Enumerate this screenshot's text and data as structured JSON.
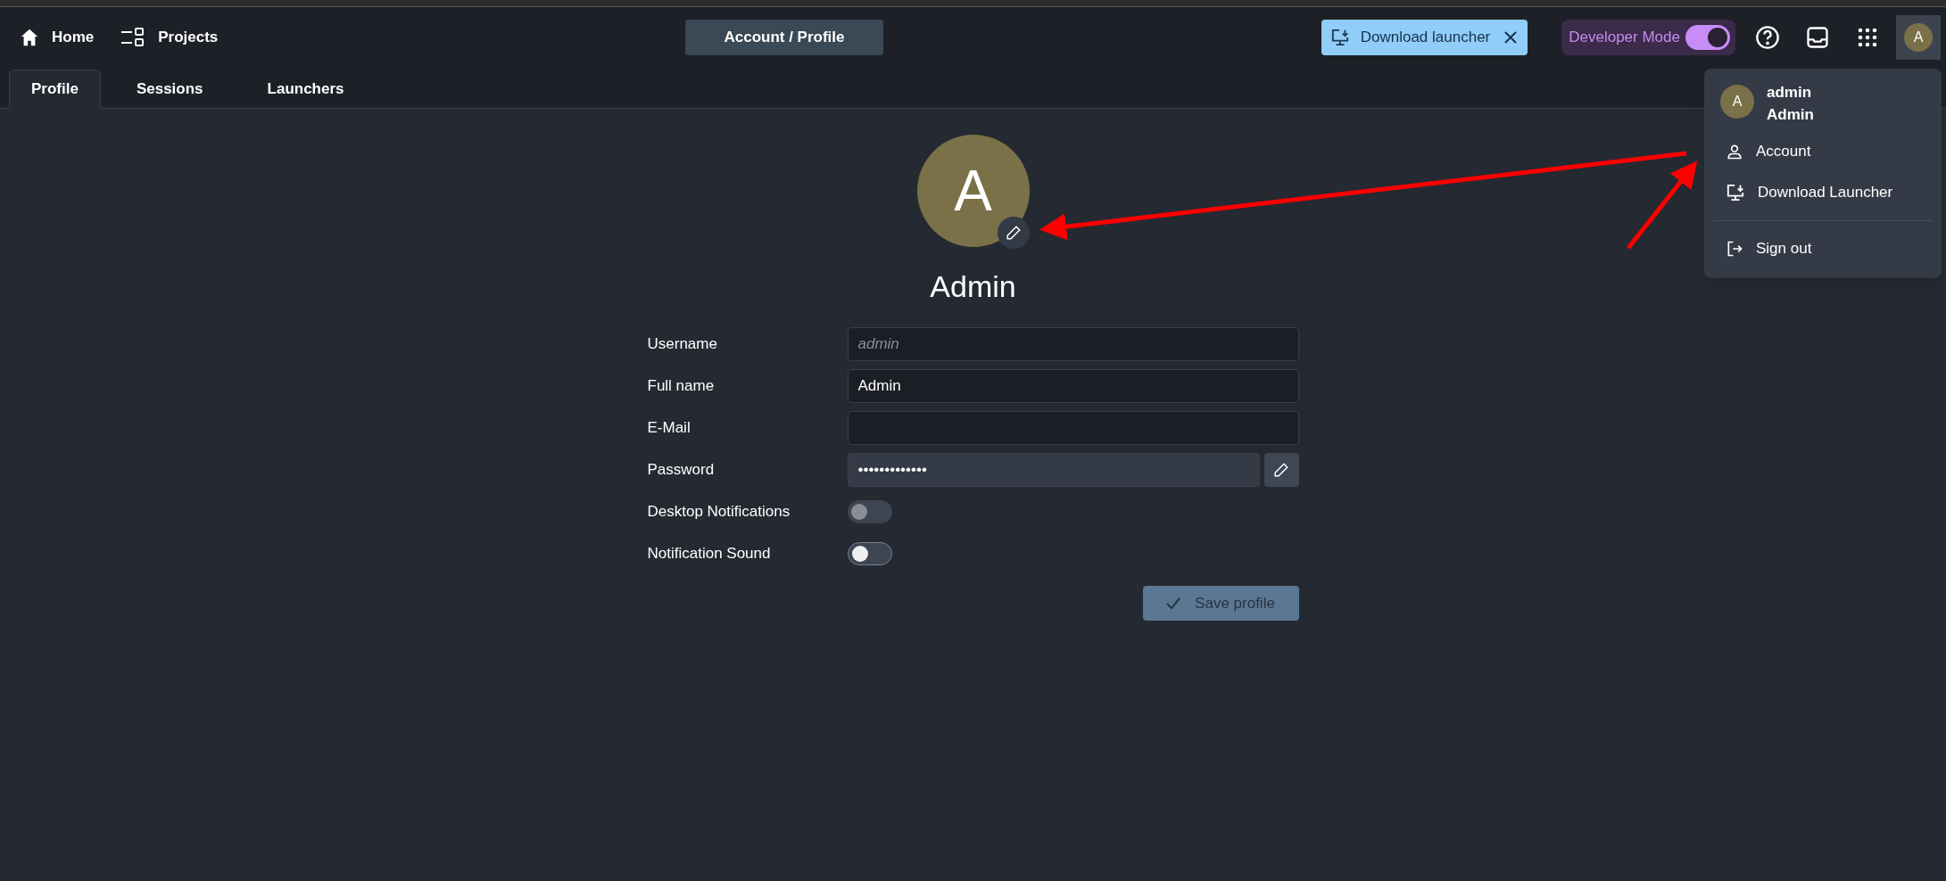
{
  "nav": [
    {
      "kind": "home",
      "label": "Home"
    },
    {
      "kind": "projects",
      "label": "Projects"
    }
  ],
  "breadcrumb": "Account / Profile",
  "download_banner": {
    "label": "Download launcher"
  },
  "developer_mode": {
    "label": "Developer Mode",
    "on": true
  },
  "user_button": {
    "initial": "A"
  },
  "tabs": [
    {
      "label": "Profile",
      "selected": true
    },
    {
      "label": "Sessions",
      "selected": false
    },
    {
      "label": "Launchers",
      "selected": false
    }
  ],
  "profile": {
    "initial": "A",
    "name": "Admin"
  },
  "form": {
    "fields": [
      {
        "kind": "text",
        "label": "Username",
        "placeholder": "admin"
      },
      {
        "kind": "text",
        "label": "Full name",
        "value": "Admin"
      },
      {
        "kind": "text",
        "label": "E-Mail"
      },
      {
        "kind": "password",
        "label": "Password",
        "value": "•••••••••••••"
      },
      {
        "kind": "toggle",
        "label": "Desktop Notifications",
        "on": false,
        "disabled": true
      },
      {
        "kind": "toggle",
        "label": "Notification Sound",
        "on": false,
        "disabled": false
      }
    ],
    "save_button": {
      "label": "Save profile",
      "disabled": true
    }
  },
  "user_menu": {
    "initial": "A",
    "username": "admin",
    "full_name": "Admin",
    "items": [
      {
        "kind": "account",
        "label": "Account"
      },
      {
        "kind": "download",
        "label": "Download Launcher"
      },
      {
        "kind": "divider"
      },
      {
        "kind": "sign_out",
        "label": "Sign out"
      }
    ]
  }
}
